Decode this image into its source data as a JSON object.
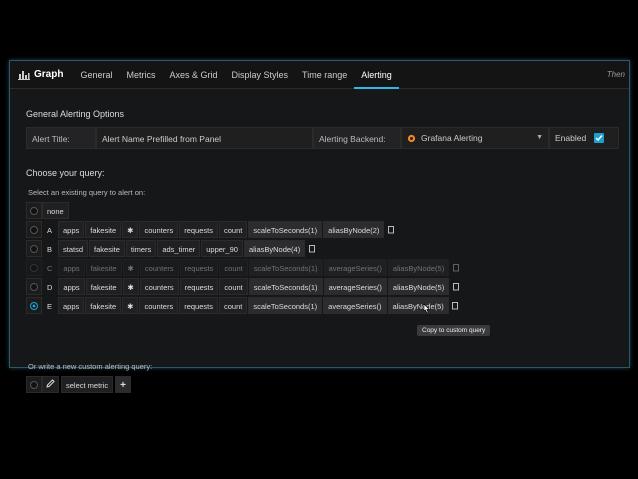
{
  "tabs": {
    "title": "Graph",
    "items": [
      "General",
      "Metrics",
      "Axes & Grid",
      "Display Styles",
      "Time range",
      "Alerting"
    ],
    "active": 5,
    "right_text": "Then"
  },
  "general": {
    "heading": "General Alerting Options",
    "alert_title_label": "Alert Title:",
    "alert_title_value": "Alert Name Prefilled from Panel",
    "backend_label": "Alerting Backend:",
    "backend_value": "Grafana Alerting",
    "enabled_label": "Enabled"
  },
  "query": {
    "heading": "Choose your query:",
    "select_label": "Select an existing query to alert on:",
    "none_label": "none",
    "rows": [
      {
        "ref": "A",
        "segments": [
          "apps",
          "fakesite",
          "✱",
          "counters",
          "requests",
          "count",
          "scaleToSeconds(1)",
          "aliasByNode(2)"
        ],
        "funcs": [
          6,
          7
        ],
        "dim": false,
        "checked": false
      },
      {
        "ref": "B",
        "segments": [
          "statsd",
          "fakesite",
          "timers",
          "ads_timer",
          "upper_90",
          "aliasByNode(4)"
        ],
        "funcs": [
          5
        ],
        "dim": false,
        "checked": false
      },
      {
        "ref": "C",
        "segments": [
          "apps",
          "fakesite",
          "✱",
          "counters",
          "requests",
          "count",
          "scaleToSeconds(1)",
          "averageSeries()",
          "aliasByNode(5)"
        ],
        "funcs": [
          6,
          7,
          8
        ],
        "dim": true,
        "checked": false
      },
      {
        "ref": "D",
        "segments": [
          "apps",
          "fakesite",
          "✱",
          "counters",
          "requests",
          "count",
          "scaleToSeconds(1)",
          "averageSeries()",
          "aliasByNode(5)"
        ],
        "funcs": [
          6,
          7,
          8
        ],
        "dim": false,
        "checked": false
      },
      {
        "ref": "E",
        "segments": [
          "apps",
          "fakesite",
          "✱",
          "counters",
          "requests",
          "count",
          "scaleToSeconds(1)",
          "averageSeries()",
          "aliasByNode(5)"
        ],
        "funcs": [
          6,
          7,
          8
        ],
        "dim": false,
        "checked": true
      }
    ],
    "tooltip": "Copy to custom query",
    "custom_label": "Or write a new custom alerting query:",
    "select_metric": "select metric",
    "add_symbol": "+"
  },
  "colors": {
    "accent": "#33b5e5",
    "checkbox": "#1e9fd4",
    "panel_border": "#2a5a6a"
  }
}
